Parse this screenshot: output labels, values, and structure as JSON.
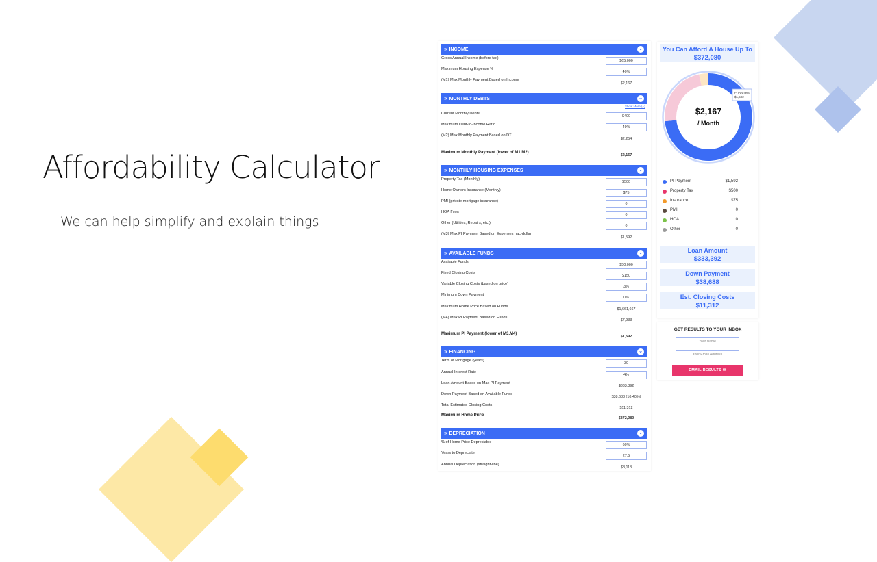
{
  "slide": {
    "title": "Affordability Calculator",
    "subtitle": "We can help simplify and explain things"
  },
  "colors": {
    "accent": "#3b6cf5",
    "button": "#e8356b",
    "panel_bg": "#eaf1fd"
  },
  "icons": {
    "section_chevron": "double-chevron-right-icon",
    "collapse": "chevron-down-icon",
    "email": "envelope-icon"
  },
  "calculator": {
    "sections": [
      {
        "title": "INCOME",
        "rows": [
          {
            "label": "Gross Annual Income (before tax)",
            "value": "$65,000",
            "kind": "field"
          },
          {
            "label": "Maximum Housing Expense %",
            "value": "40%",
            "kind": "field"
          },
          {
            "label": "(M1) Max Monthly Payment Based on Income",
            "value": "$2,167",
            "kind": "value"
          }
        ]
      },
      {
        "title": "MONTHLY DEBTS",
        "show_more": "Show More (+)",
        "rows": [
          {
            "label": "Current Monthly Debts",
            "value": "$400",
            "kind": "field"
          },
          {
            "label": "Maximum Debt-to-Income Ratio",
            "value": "49%",
            "kind": "field"
          },
          {
            "label": "(M2) Max Monthly Payment Based on DTI",
            "value": "$2,254",
            "kind": "value"
          },
          {
            "label": "Maximum Monthly Payment (lower of M1,M2)",
            "value": "$2,167",
            "kind": "bold"
          }
        ]
      },
      {
        "title": "MONTHLY HOUSING EXPENSES",
        "rows": [
          {
            "label": "Property Tax (Monthly)",
            "value": "$500",
            "kind": "field"
          },
          {
            "label": "Home Owners Insurance (Monthly)",
            "value": "$75",
            "kind": "field"
          },
          {
            "label": "PMI (private mortgage insurance)",
            "value": "0",
            "kind": "field"
          },
          {
            "label": "HOA Fees",
            "value": "0",
            "kind": "field"
          },
          {
            "label": "Other (Utilities, Repairs, etc.)",
            "value": "0",
            "kind": "field"
          },
          {
            "label": "(M3) Max PI Payment Based on Expenses hac-dollar",
            "value": "$1,592",
            "kind": "value"
          }
        ]
      },
      {
        "title": "AVAILABLE FUNDS",
        "rows": [
          {
            "label": "Available Funds",
            "value": "$50,000",
            "kind": "field"
          },
          {
            "label": "Fixed Closing Costs",
            "value": "$150",
            "kind": "field"
          },
          {
            "label": "Variable Closing Costs (based on price)",
            "value": "3%",
            "kind": "field"
          },
          {
            "label": "Minimum Down Payment",
            "value": "0%",
            "kind": "field"
          },
          {
            "label": "Maximum Home Price Based on Funds",
            "value": "$1,661,667",
            "kind": "value"
          },
          {
            "label": "(M4) Max PI Payment Based on Funds",
            "value": "$7,933",
            "kind": "value"
          },
          {
            "label": "Maximum PI Payment (lower of M3,M4)",
            "value": "$1,592",
            "kind": "bold"
          }
        ]
      },
      {
        "title": "FINANCING",
        "rows": [
          {
            "label": "Term of Mortgage (years)",
            "value": "30",
            "kind": "field"
          },
          {
            "label": "Annual Interest Rate",
            "value": "4%",
            "kind": "field"
          },
          {
            "label": "Loan Amount Based on Max PI Payment",
            "value": "$333,392",
            "kind": "value"
          },
          {
            "label": "Down Payment Based on Available Funds",
            "value": "$38,688 (10.40%)",
            "kind": "value"
          },
          {
            "label": "Total Estimated Closing Costs",
            "value": "$11,312",
            "kind": "value"
          },
          {
            "label": "Maximum Home Price",
            "value": "$372,080",
            "kind": "bold"
          }
        ]
      },
      {
        "title": "DEPRECIATION",
        "rows": [
          {
            "label": "% of Home Price Depreciable",
            "value": "60%",
            "kind": "field"
          },
          {
            "label": "Years to Depreciate",
            "value": "27.5",
            "kind": "field"
          },
          {
            "label": "Annual Depreciation (straight-line)",
            "value": "$8,118",
            "kind": "value"
          }
        ]
      }
    ]
  },
  "summary": {
    "headline": "You Can Afford A House Up To",
    "amount": "$372,080",
    "donut": {
      "center_amount": "$2,167",
      "center_unit": "/ Month",
      "tooltip_label": "PI Payment",
      "tooltip_value": "$1,592",
      "slices": [
        {
          "name": "PI Payment",
          "value": 1592,
          "color": "#3b6cf5"
        },
        {
          "name": "Property Tax",
          "value": 500,
          "color": "#f6c9d8"
        },
        {
          "name": "Insurance",
          "value": 75,
          "color": "#fde6c4"
        }
      ]
    },
    "legend": [
      {
        "name": "PI Payment",
        "value": "$1,592",
        "color": "#3b6cf5"
      },
      {
        "name": "Property Tax",
        "value": "$500",
        "color": "#e8356b"
      },
      {
        "name": "Insurance",
        "value": "$75",
        "color": "#f39a2b"
      },
      {
        "name": "PMI",
        "value": "0",
        "color": "#5b4a3f"
      },
      {
        "name": "HOA",
        "value": "0",
        "color": "#7cc24a"
      },
      {
        "name": "Other",
        "value": "0",
        "color": "#9a9a9a"
      }
    ],
    "cards": [
      {
        "title": "Loan Amount",
        "value": "$333,392"
      },
      {
        "title": "Down Payment",
        "value": "$38,688"
      },
      {
        "title": "Est. Closing Costs",
        "value": "$11,312"
      }
    ]
  },
  "inbox": {
    "title": "GET RESULTS TO YOUR INBOX",
    "name_placeholder": "Your Name",
    "email_placeholder": "Your Email Address",
    "button_label": "EMAIL RESULTS"
  }
}
